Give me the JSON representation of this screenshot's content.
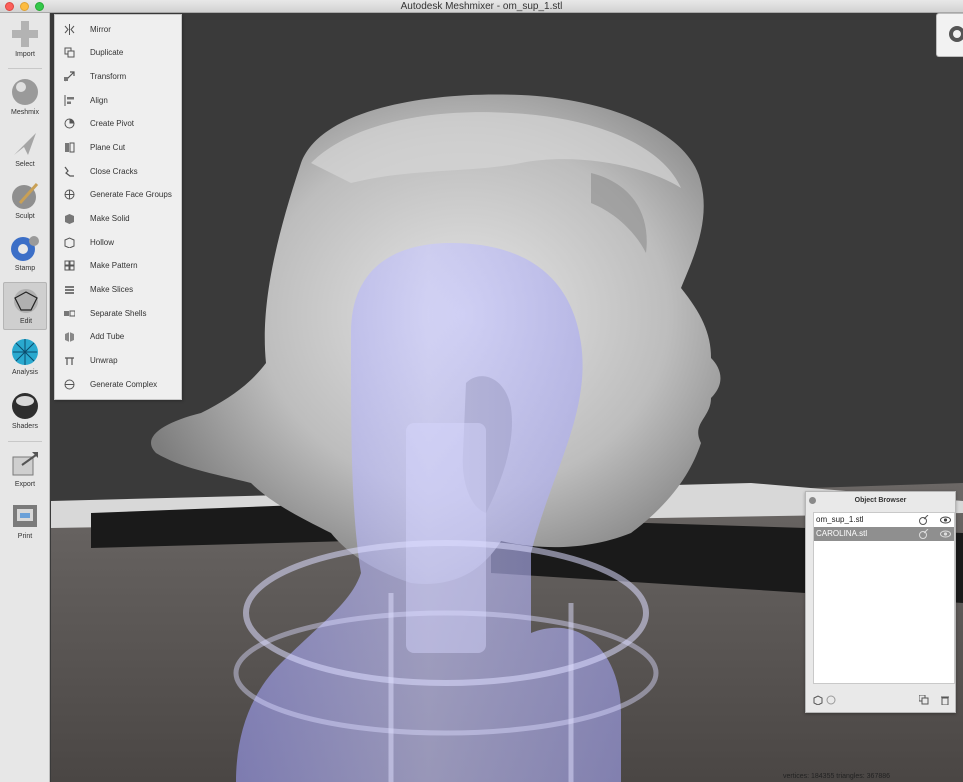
{
  "window": {
    "title": "Autodesk Meshmixer - om_sup_1.stl"
  },
  "toolbar": {
    "tools": [
      {
        "label": "Import",
        "icon": "plus-icon"
      },
      {
        "label": "Meshmix",
        "icon": "bunny-sphere-icon"
      },
      {
        "label": "Select",
        "icon": "arrow-cursor-icon"
      },
      {
        "label": "Sculpt",
        "icon": "brush-sphere-icon"
      },
      {
        "label": "Stamp",
        "icon": "stamp-sphere-icon"
      },
      {
        "label": "Edit",
        "icon": "wireframe-sphere-icon"
      },
      {
        "label": "Analysis",
        "icon": "analysis-sphere-icon"
      },
      {
        "label": "Shaders",
        "icon": "shiny-sphere-icon"
      },
      {
        "label": "Export",
        "icon": "export-icon"
      },
      {
        "label": "Print",
        "icon": "printer-icon"
      }
    ],
    "active": "Edit"
  },
  "edit_menu": {
    "items": [
      {
        "label": "Mirror",
        "icon": "mirror-icon"
      },
      {
        "label": "Duplicate",
        "icon": "duplicate-icon"
      },
      {
        "label": "Transform",
        "icon": "transform-icon"
      },
      {
        "label": "Align",
        "icon": "align-icon"
      },
      {
        "label": "Create Pivot",
        "icon": "pivot-icon"
      },
      {
        "label": "Plane Cut",
        "icon": "plane-cut-icon"
      },
      {
        "label": "Close Cracks",
        "icon": "close-cracks-icon"
      },
      {
        "label": "Generate Face Groups",
        "icon": "face-groups-icon"
      },
      {
        "label": "Make Solid",
        "icon": "make-solid-icon"
      },
      {
        "label": "Hollow",
        "icon": "hollow-icon"
      },
      {
        "label": "Make Pattern",
        "icon": "pattern-icon"
      },
      {
        "label": "Make Slices",
        "icon": "slices-icon"
      },
      {
        "label": "Separate Shells",
        "icon": "shells-icon"
      },
      {
        "label": "Add Tube",
        "icon": "tube-icon"
      },
      {
        "label": "Unwrap",
        "icon": "unwrap-icon"
      },
      {
        "label": "Generate Complex",
        "icon": "complex-icon"
      }
    ]
  },
  "object_browser": {
    "title": "Object Browser",
    "objects": [
      {
        "name": "om_sup_1.stl",
        "selected": false
      },
      {
        "name": "CAROLINA.stl",
        "selected": true
      }
    ]
  },
  "status": {
    "text": "vertices: 184355 triangles: 367886"
  },
  "colors": {
    "toolbar_bg": "#e7e7e7",
    "menu_bg": "#efefef",
    "viewport_bg": "#3a3a3a",
    "floor": "#5a5654",
    "mesh": "#c9c9c9",
    "support": "#aaaaff",
    "selection": "#8f8f8f"
  }
}
